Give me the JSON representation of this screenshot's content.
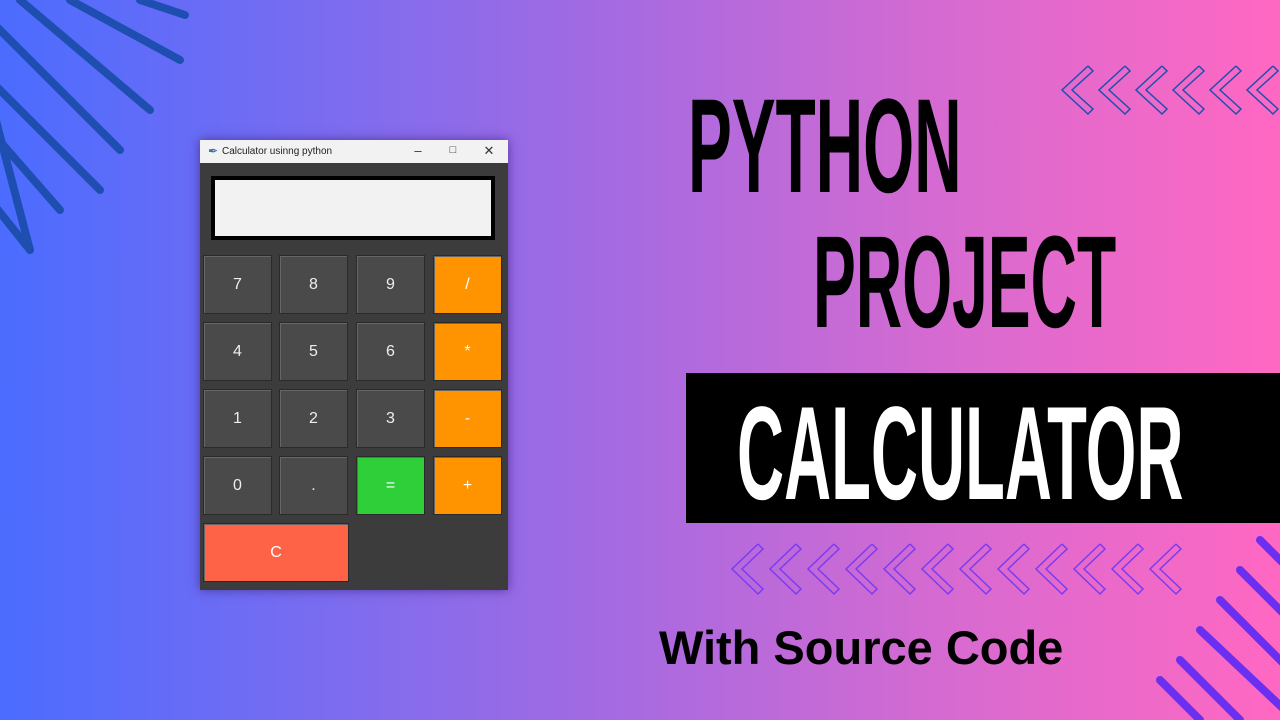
{
  "window": {
    "title": "Calculator usinng python",
    "icon": "feather-icon",
    "controls": [
      "minimize-icon",
      "maximize-icon",
      "close-icon"
    ],
    "display_value": ""
  },
  "buttons": [
    {
      "label": "7",
      "kind": "num"
    },
    {
      "label": "8",
      "kind": "num"
    },
    {
      "label": "9",
      "kind": "num"
    },
    {
      "label": "/",
      "kind": "op"
    },
    {
      "label": "4",
      "kind": "num"
    },
    {
      "label": "5",
      "kind": "num"
    },
    {
      "label": "6",
      "kind": "num"
    },
    {
      "label": "*",
      "kind": "op"
    },
    {
      "label": "1",
      "kind": "num"
    },
    {
      "label": "2",
      "kind": "num"
    },
    {
      "label": "3",
      "kind": "num"
    },
    {
      "label": "-",
      "kind": "op"
    },
    {
      "label": "0",
      "kind": "num"
    },
    {
      "label": ".",
      "kind": "num"
    },
    {
      "label": "=",
      "kind": "eq"
    },
    {
      "label": "+",
      "kind": "op"
    },
    {
      "label": "C",
      "kind": "clr"
    }
  ],
  "headline": {
    "line1": "PYTHON",
    "line2": "PROJECT",
    "line3": "CALCULATOR",
    "subtitle": "With Source Code"
  },
  "colors": {
    "operator": "#ff9400",
    "equals": "#2fcf3a",
    "clear": "#ff6347",
    "number": "#4a4a4a"
  }
}
